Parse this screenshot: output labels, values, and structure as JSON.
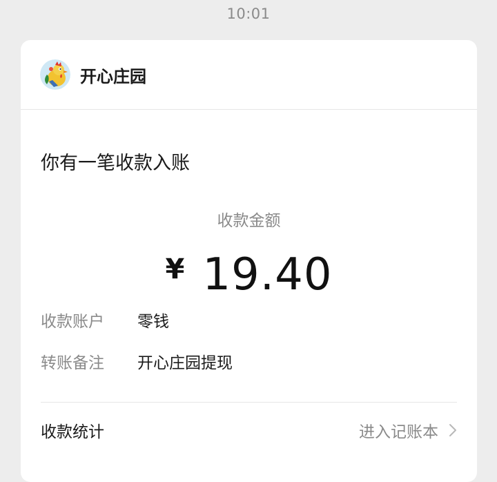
{
  "timestamp": "10:01",
  "card": {
    "app_name": "开心庄园",
    "avatar_icon": "rooster-icon",
    "headline": "你有一笔收款入账",
    "amount_label": "收款金额",
    "currency": "¥",
    "amount": "19.40",
    "details": [
      {
        "key": "收款账户",
        "value": "零钱"
      },
      {
        "key": "转账备注",
        "value": "开心庄园提现"
      }
    ],
    "footer_label": "收款统计",
    "footer_link": "进入记账本",
    "chevron_icon": "chevron-right-icon"
  }
}
